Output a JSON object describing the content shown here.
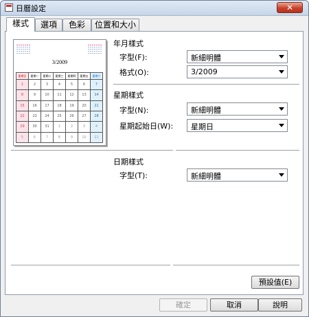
{
  "window": {
    "title": "日曆設定",
    "close_glyph": "✕"
  },
  "tabs": [
    {
      "label": "樣式",
      "active": true
    },
    {
      "label": "選項",
      "active": false
    },
    {
      "label": "色彩",
      "active": false
    },
    {
      "label": "位置和大小",
      "active": false
    }
  ],
  "preview": {
    "month_label": "3/2009",
    "weekdays": [
      "星期日",
      "星期一",
      "星期二",
      "星期三",
      "星期四",
      "星期五",
      "星期六"
    ],
    "weeks": [
      [
        "1",
        "2",
        "3",
        "4",
        "5",
        "6",
        "7"
      ],
      [
        "8",
        "9",
        "10",
        "11",
        "12",
        "13",
        "14"
      ],
      [
        "15",
        "16",
        "17",
        "18",
        "19",
        "20",
        "21"
      ],
      [
        "22",
        "23",
        "24",
        "25",
        "26",
        "27",
        "28"
      ],
      [
        "29",
        "30",
        "31",
        "1",
        "2",
        "3",
        "4"
      ],
      [
        "5",
        "6",
        "7",
        "8",
        "9",
        "10",
        "11"
      ]
    ]
  },
  "year_month_style": {
    "heading": "年月樣式",
    "font_label": "字型(F):",
    "font_value": "新細明體",
    "format_label": "格式(O):",
    "format_value": "3/2009"
  },
  "weekday_style": {
    "heading": "星期樣式",
    "font_label": "字型(N):",
    "font_value": "新細明體",
    "start_day_label": "星期起始日(W):",
    "start_day_value": "星期日"
  },
  "date_style": {
    "heading": "日期樣式",
    "font_label": "字型(T):",
    "font_value": "新細明體"
  },
  "buttons": {
    "defaults": "預設值(E)",
    "ok": "確定",
    "cancel": "取消",
    "help": "說明"
  }
}
